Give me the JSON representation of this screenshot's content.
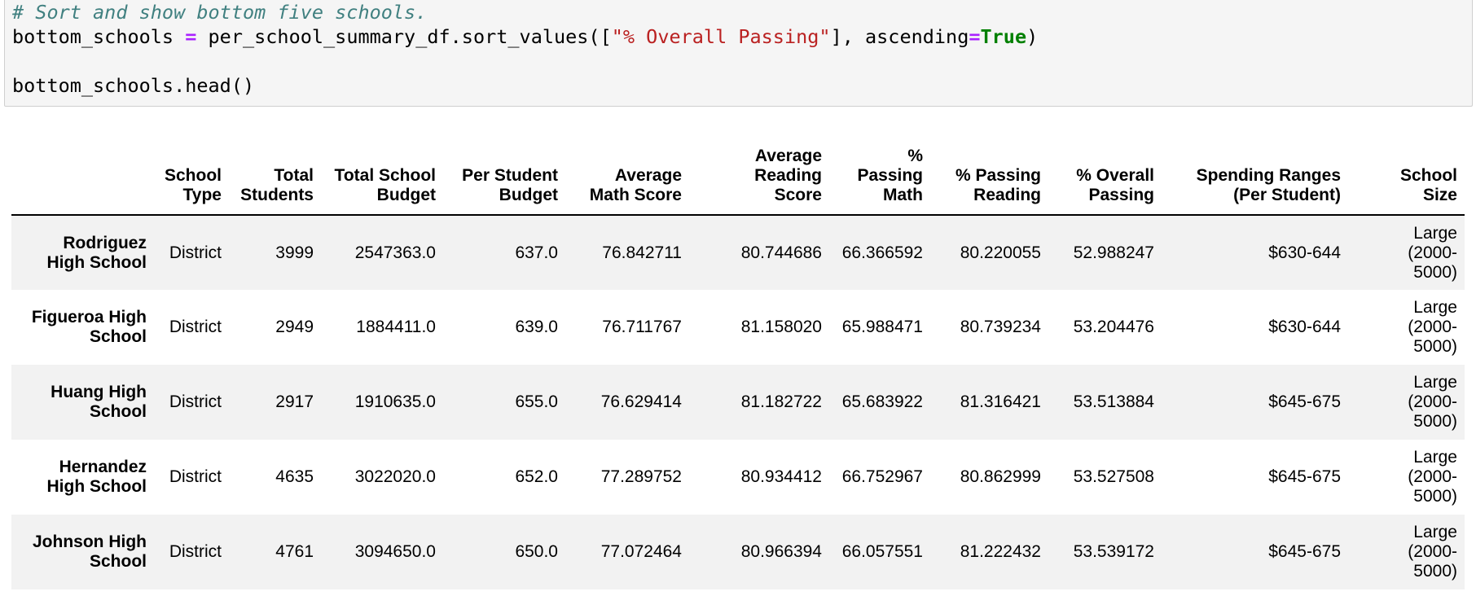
{
  "code": {
    "comment": "# Sort and show bottom five schools.",
    "line2_var": "bottom_schools ",
    "line2_op": "=",
    "line2_mid": " per_school_summary_df.sort_values([",
    "line2_str": "\"% Overall Passing\"",
    "line2_after": "], ascending",
    "line2_eq": "=",
    "line2_kw": "True",
    "line2_close": ")",
    "line4": "bottom_schools.head()"
  },
  "table": {
    "headers": [
      [
        "",
        ""
      ],
      [
        "School",
        "Type"
      ],
      [
        "Total",
        "Students"
      ],
      [
        "Total School",
        "Budget"
      ],
      [
        "Per Student",
        "Budget"
      ],
      [
        "Average",
        "Math Score"
      ],
      [
        "Average",
        "Reading",
        "Score"
      ],
      [
        "%",
        "Passing",
        "Math"
      ],
      [
        "% Passing",
        "Reading"
      ],
      [
        "% Overall",
        "Passing"
      ],
      [
        "Spending Ranges",
        "(Per Student)"
      ],
      [
        "School",
        "Size"
      ]
    ],
    "rows": [
      {
        "name": [
          "Rodriguez",
          "High School"
        ],
        "cells": [
          "District",
          "3999",
          "2547363.0",
          "637.0",
          "76.842711",
          "80.744686",
          "66.366592",
          "80.220055",
          "52.988247",
          "$630-644"
        ],
        "size": [
          "Large",
          "(2000-",
          "5000)"
        ]
      },
      {
        "name": [
          "Figueroa High",
          "School"
        ],
        "cells": [
          "District",
          "2949",
          "1884411.0",
          "639.0",
          "76.711767",
          "81.158020",
          "65.988471",
          "80.739234",
          "53.204476",
          "$630-644"
        ],
        "size": [
          "Large",
          "(2000-",
          "5000)"
        ]
      },
      {
        "name": [
          "Huang High",
          "School"
        ],
        "cells": [
          "District",
          "2917",
          "1910635.0",
          "655.0",
          "76.629414",
          "81.182722",
          "65.683922",
          "81.316421",
          "53.513884",
          "$645-675"
        ],
        "size": [
          "Large",
          "(2000-",
          "5000)"
        ]
      },
      {
        "name": [
          "Hernandez",
          "High School"
        ],
        "cells": [
          "District",
          "4635",
          "3022020.0",
          "652.0",
          "77.289752",
          "80.934412",
          "66.752967",
          "80.862999",
          "53.527508",
          "$645-675"
        ],
        "size": [
          "Large",
          "(2000-",
          "5000)"
        ]
      },
      {
        "name": [
          "Johnson High",
          "School"
        ],
        "cells": [
          "District",
          "4761",
          "3094650.0",
          "650.0",
          "77.072464",
          "80.966394",
          "66.057551",
          "81.222432",
          "53.539172",
          "$645-675"
        ],
        "size": [
          "Large",
          "(2000-",
          "5000)"
        ]
      }
    ]
  }
}
